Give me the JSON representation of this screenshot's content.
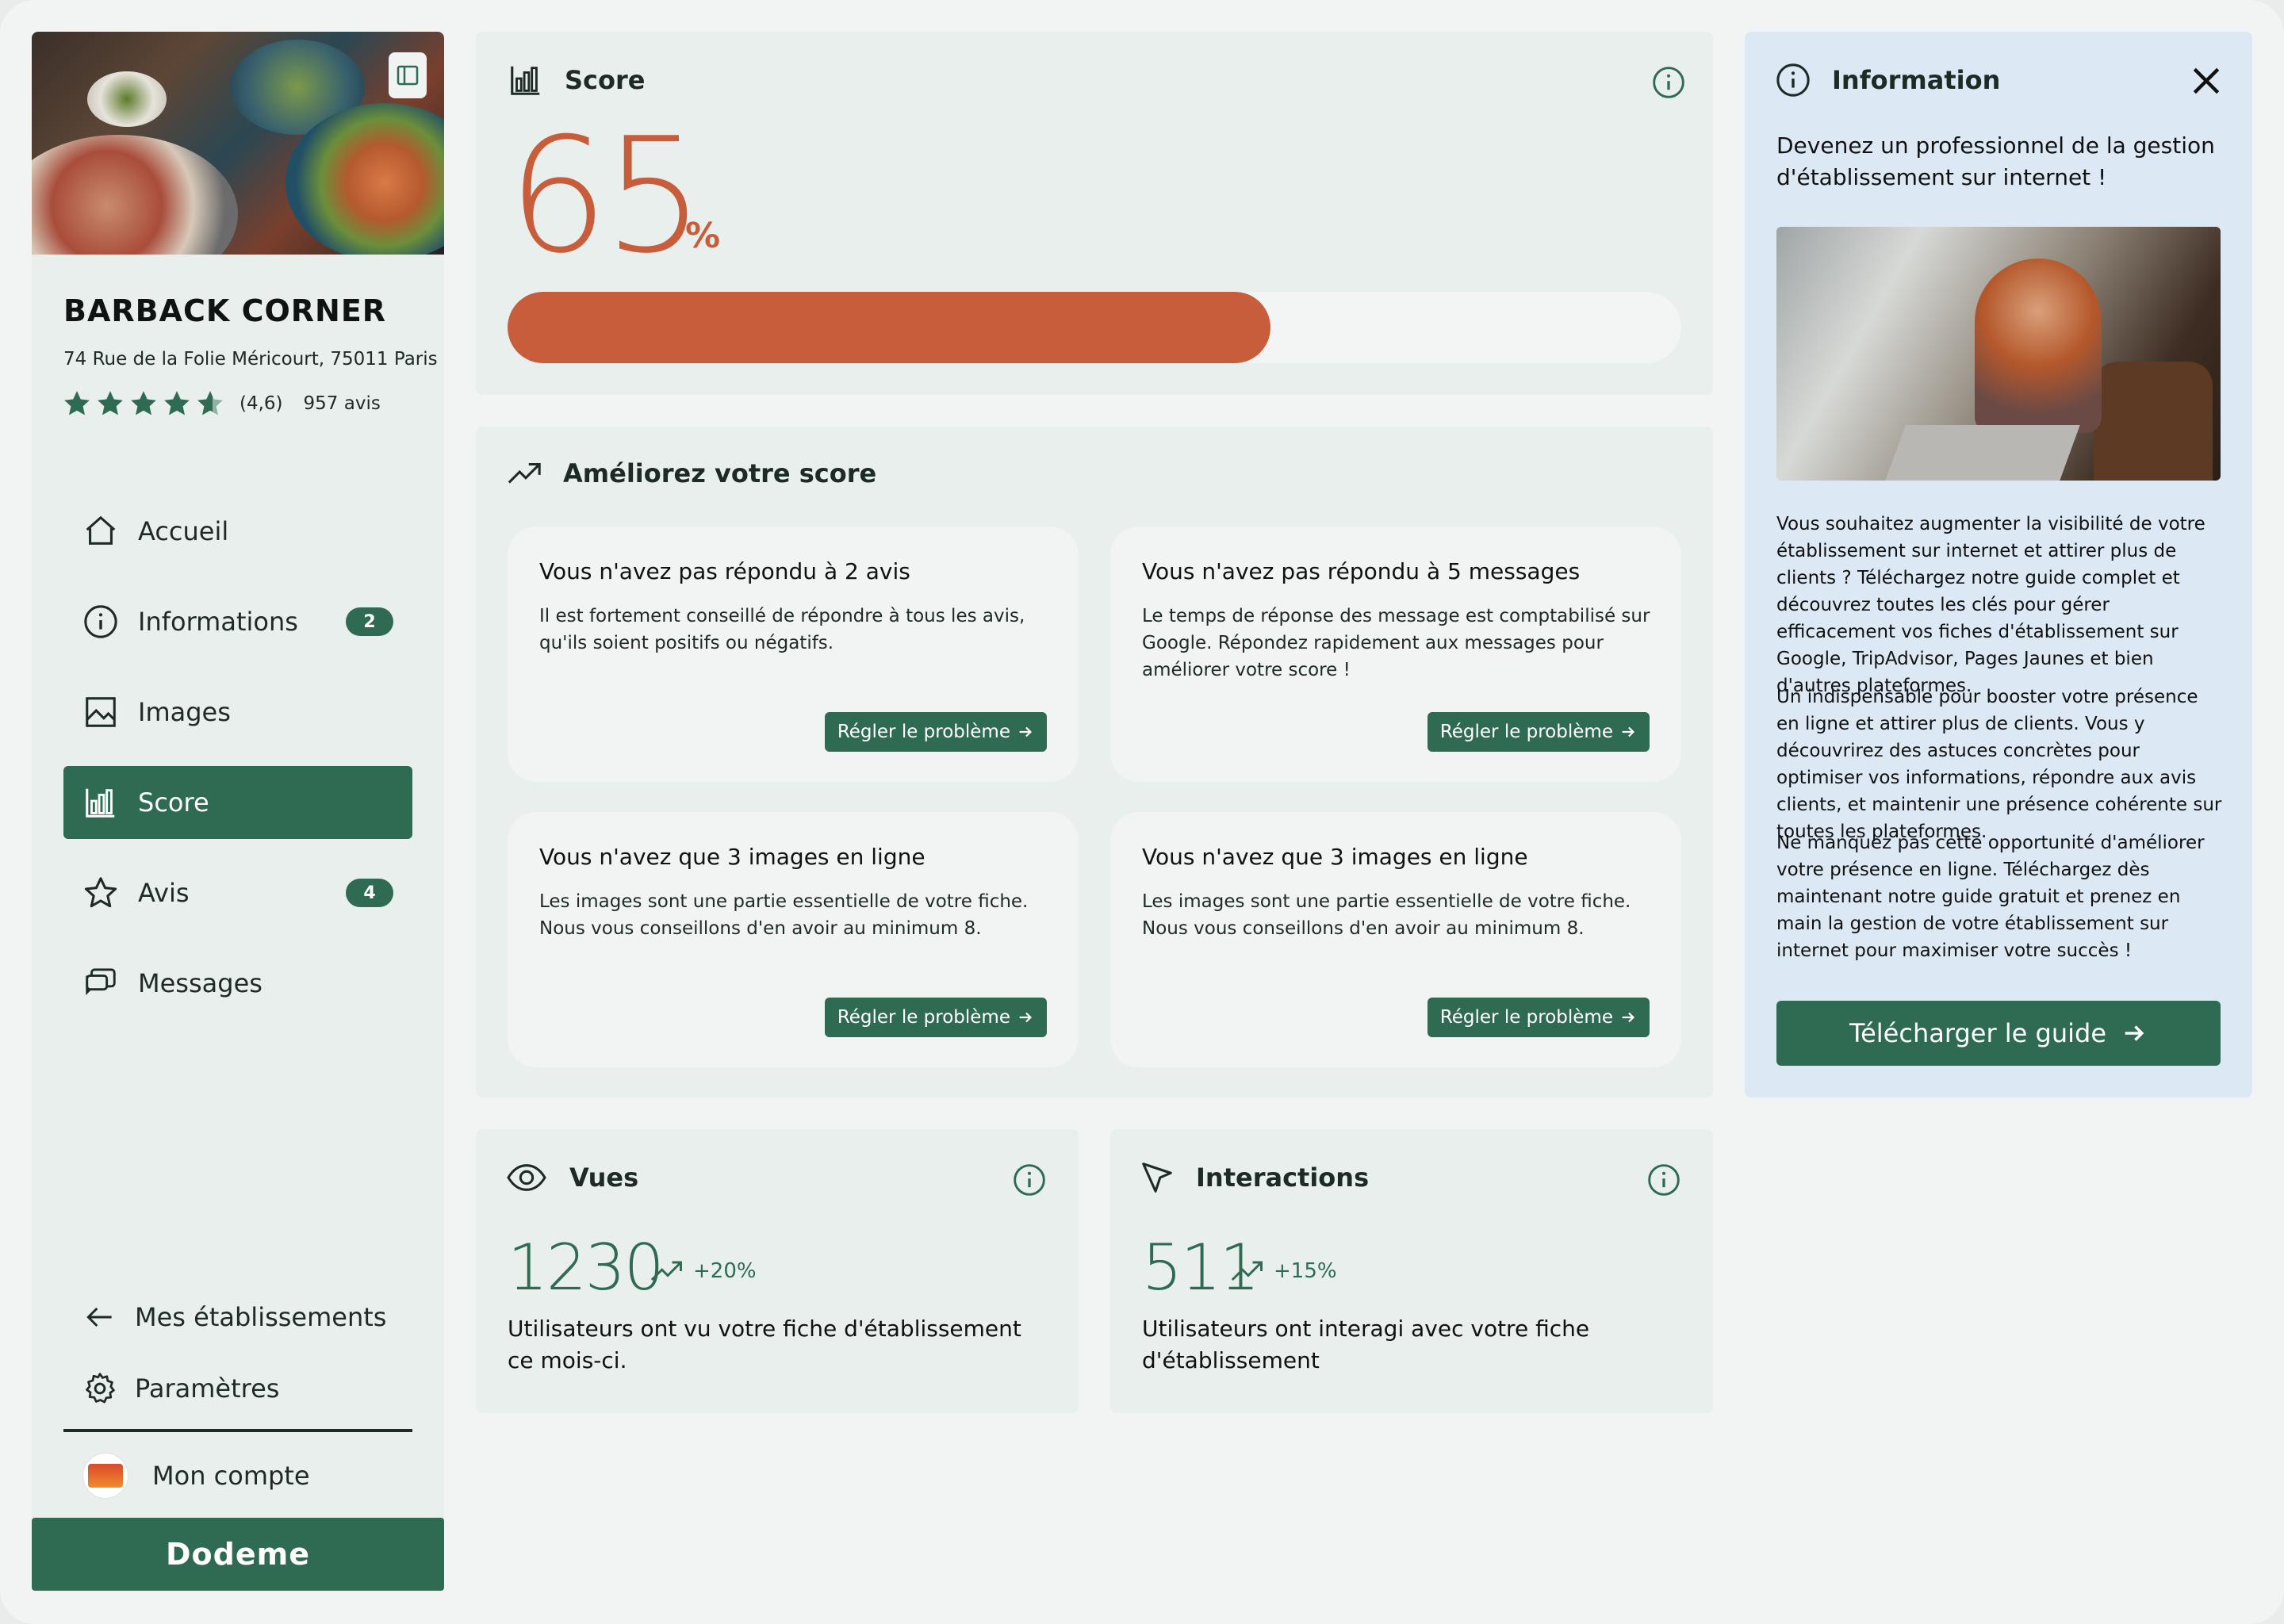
{
  "establishment": {
    "name": "BARBACK CORNER",
    "address": "74 Rue de la Folie Méricourt, 75011 Paris",
    "rating_value": "(4,6)",
    "rating_stars": 4.6,
    "reviews_count": "957 avis"
  },
  "nav": {
    "items": [
      {
        "label": "Accueil",
        "icon": "home-icon"
      },
      {
        "label": "Informations",
        "icon": "info-icon",
        "badge": "2"
      },
      {
        "label": "Images",
        "icon": "image-icon"
      },
      {
        "label": "Score",
        "icon": "bar-chart-icon",
        "active": true
      },
      {
        "label": "Avis",
        "icon": "star-icon",
        "badge": "4"
      },
      {
        "label": "Messages",
        "icon": "chat-icon"
      }
    ],
    "my_establishments": "Mes établissements",
    "settings": "Paramètres",
    "account": "Mon compte"
  },
  "footer_brand": "Dodeme",
  "score": {
    "title": "Score",
    "value": "65",
    "unit": "%",
    "progress_percent": 65
  },
  "improve": {
    "title": "Améliorez votre score",
    "fix_label": "Régler le problème",
    "issues": [
      {
        "title": "Vous n'avez pas répondu à 2 avis",
        "desc": "Il est fortement conseillé de répondre à tous les avis, qu'ils soient positifs ou négatifs."
      },
      {
        "title": "Vous n'avez pas répondu à 5 messages",
        "desc": "Le temps de réponse des message est comptabilisé sur Google. Répondez rapidement aux messages pour améliorer votre score !"
      },
      {
        "title": "Vous n'avez que 3 images en ligne",
        "desc": "Les images sont une partie essentielle de votre fiche. Nous vous conseillons d'en avoir au minimum 8."
      },
      {
        "title": "Vous n'avez que 3 images en ligne",
        "desc": "Les images sont une partie essentielle de votre fiche. Nous vous conseillons d'en avoir au minimum 8."
      }
    ]
  },
  "views": {
    "title": "Vues",
    "value": "1230",
    "trend": "+20%",
    "desc": "Utilisateurs ont vu votre fiche d'établissement ce mois-ci."
  },
  "interactions": {
    "title": "Interactions",
    "value": "511",
    "trend": "+15%",
    "desc": "Utilisateurs ont interagi avec votre fiche d'établissement"
  },
  "info_panel": {
    "title": "Information",
    "headline": "Devenez un professionnel de la gestion d'établissement sur internet !",
    "paragraphs": [
      "Vous souhaitez augmenter la visibilité de votre établissement sur internet et attirer plus de clients ? Téléchargez notre guide complet et découvrez toutes les clés pour gérer efficacement vos fiches d'établissement sur Google, TripAdvisor, Pages Jaunes et bien d'autres plateformes.",
      "Un indispensable pour booster votre présence en ligne et attirer plus de clients. Vous y découvrirez des astuces concrètes pour optimiser vos informations, répondre aux avis clients, et maintenir une présence cohérente sur toutes les plateformes.",
      "Ne manquez pas cette opportunité d'améliorer votre présence en ligne. Téléchargez dès maintenant notre guide gratuit et prenez en main la gestion de votre établissement sur internet pour maximiser votre succès !"
    ],
    "download_label": "Télécharger le guide"
  },
  "colors": {
    "accent_green": "#2f6b53",
    "score_orange": "#c85d3c",
    "panel_bg": "#e8efec",
    "info_bg": "#dce9f5"
  }
}
